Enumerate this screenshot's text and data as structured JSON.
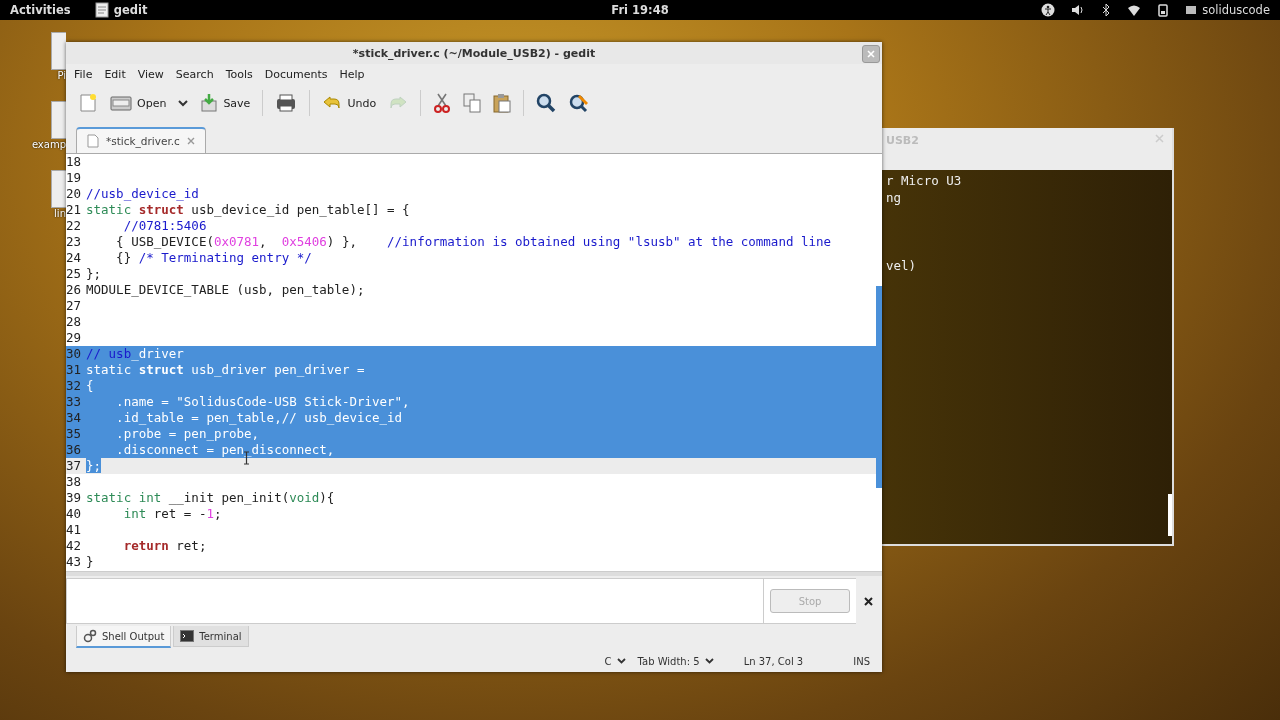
{
  "top_bar": {
    "activities": "Activities",
    "app": "gedit",
    "clock": "Fri 19:48",
    "user": "soliduscode"
  },
  "desktop_icons": [
    {
      "label": "Pi"
    },
    {
      "label": "examp"
    },
    {
      "label": "lin"
    }
  ],
  "background_window": {
    "title": "USB2",
    "blocks": [
      [
        "r Micro U3",
        "ng"
      ],
      [
        "vel)"
      ]
    ]
  },
  "window": {
    "title": "*stick_driver.c (~/Module_USB2) - gedit"
  },
  "menu": [
    "File",
    "Edit",
    "View",
    "Search",
    "Tools",
    "Documents",
    "Help"
  ],
  "toolbar": [
    {
      "kind": "new",
      "disabled": false
    },
    {
      "kind": "open",
      "label": "Open",
      "disabled": false
    },
    {
      "kind": "dropdown",
      "disabled": false
    },
    {
      "kind": "save",
      "label": "Save",
      "disabled": false
    },
    {
      "kind": "separator"
    },
    {
      "kind": "print",
      "disabled": false
    },
    {
      "kind": "separator"
    },
    {
      "kind": "undo",
      "label": "Undo",
      "disabled": false
    },
    {
      "kind": "redo",
      "disabled": true
    },
    {
      "kind": "separator"
    },
    {
      "kind": "cut",
      "disabled": false
    },
    {
      "kind": "copy",
      "disabled": false
    },
    {
      "kind": "paste",
      "disabled": false
    },
    {
      "kind": "separator"
    },
    {
      "kind": "search",
      "disabled": false
    },
    {
      "kind": "replace",
      "disabled": false
    }
  ],
  "tabs": [
    {
      "label": "*stick_driver.c",
      "selected": true
    }
  ],
  "code": [
    {
      "number": "18"
    },
    {
      "number": "19"
    },
    {
      "number": "20",
      "segments": [
        {
          "text": "//usb_device_id",
          "kind": "comment"
        }
      ]
    },
    {
      "number": "21",
      "segments": [
        {
          "text": "static",
          "kind": "type"
        },
        {
          "text": " struct",
          "kind": "keyword"
        },
        {
          "text": " usb_device_id pen_table[] = {",
          "kind": "plain"
        }
      ]
    },
    {
      "number": "22",
      "segments": [
        {
          "text": "     //0781:5406",
          "kind": "comment"
        }
      ]
    },
    {
      "number": "23",
      "segments": [
        {
          "text": "    { USB_DEVICE(",
          "kind": "plain"
        },
        {
          "text": "0x0781",
          "kind": "number"
        },
        {
          "text": ",  ",
          "kind": "plain"
        },
        {
          "text": "0x5406",
          "kind": "number"
        },
        {
          "text": ") },    ",
          "kind": "plain"
        },
        {
          "text": "//information is obtained using \"lsusb\" at the command line",
          "kind": "comment"
        }
      ]
    },
    {
      "number": "24",
      "segments": [
        {
          "text": "    {} ",
          "kind": "plain"
        },
        {
          "text": "/* Terminating entry */",
          "kind": "comment"
        }
      ]
    },
    {
      "number": "25",
      "segments": [
        {
          "text": "};",
          "kind": "plain"
        }
      ]
    },
    {
      "number": "26",
      "segments": [
        {
          "text": "MODULE_DEVICE_TABLE (usb, pen_table);",
          "kind": "plain"
        }
      ]
    },
    {
      "number": "27"
    },
    {
      "number": "28"
    },
    {
      "number": "29"
    },
    {
      "number": "30",
      "fill_to_end": true,
      "segments": [
        {
          "text": "// usb",
          "kind": "comment"
        },
        {
          "text": "_driver",
          "kind": "comment",
          "selected": true
        }
      ]
    },
    {
      "number": "31",
      "fill_to_end": true,
      "segments": [
        {
          "text": "static",
          "kind": "type",
          "selected": true
        },
        {
          "text": " struct",
          "kind": "keyword",
          "selected": true
        },
        {
          "text": " usb_driver pen_driver =",
          "kind": "plain",
          "selected": true
        }
      ]
    },
    {
      "number": "32",
      "fill_to_end": true,
      "segments": [
        {
          "text": "{",
          "kind": "plain",
          "selected": true
        }
      ]
    },
    {
      "number": "33",
      "fill_to_end": true,
      "segments": [
        {
          "text": "    .name = ",
          "kind": "plain",
          "selected": true
        },
        {
          "text": "\"SolidusCode-USB Stick-Driver\"",
          "kind": "string",
          "selected": true
        },
        {
          "text": ",",
          "kind": "plain",
          "selected": true
        }
      ]
    },
    {
      "number": "34",
      "fill_to_end": true,
      "segments": [
        {
          "text": "    .id_table = pen_table,",
          "kind": "plain",
          "selected": true
        },
        {
          "text": "// usb_device_id",
          "kind": "comment",
          "selected": true
        }
      ]
    },
    {
      "number": "35",
      "fill_to_end": true,
      "segments": [
        {
          "text": "    .probe = pen_probe,",
          "kind": "plain",
          "selected": true
        }
      ]
    },
    {
      "number": "36",
      "fill_to_end": true,
      "segments": [
        {
          "text": "    .disconnect = pen_disconnect,",
          "kind": "plain",
          "selected": true
        }
      ]
    },
    {
      "number": "37",
      "current": true,
      "segments": [
        {
          "text": "};",
          "kind": "plain",
          "selected": true
        }
      ]
    },
    {
      "number": "38"
    },
    {
      "number": "39",
      "segments": [
        {
          "text": "static",
          "kind": "type"
        },
        {
          "text": " int",
          "kind": "type"
        },
        {
          "text": " __init pen_init(",
          "kind": "plain"
        },
        {
          "text": "void",
          "kind": "type"
        },
        {
          "text": "){",
          "kind": "plain"
        }
      ]
    },
    {
      "number": "40",
      "segments": [
        {
          "text": "     int",
          "kind": "type"
        },
        {
          "text": " ret = -",
          "kind": "plain"
        },
        {
          "text": "1",
          "kind": "number"
        },
        {
          "text": ";",
          "kind": "plain"
        }
      ]
    },
    {
      "number": "41"
    },
    {
      "number": "42",
      "segments": [
        {
          "text": "     return",
          "kind": "keyword"
        },
        {
          "text": " ret;",
          "kind": "plain"
        }
      ]
    },
    {
      "number": "43",
      "segments": [
        {
          "text": "}",
          "kind": "plain"
        }
      ]
    }
  ],
  "bottom_panel": {
    "stop_button": {
      "label": "Stop",
      "disabled": true
    },
    "tabs": [
      {
        "label": "Shell Output",
        "kind": "shell",
        "selected": true
      },
      {
        "label": "Terminal",
        "kind": "terminal",
        "selected": false
      }
    ]
  },
  "status_bar": {
    "language": "C",
    "tab_width": "Tab Width:  5",
    "position": "Ln 37, Col 3",
    "mode": "INS"
  }
}
